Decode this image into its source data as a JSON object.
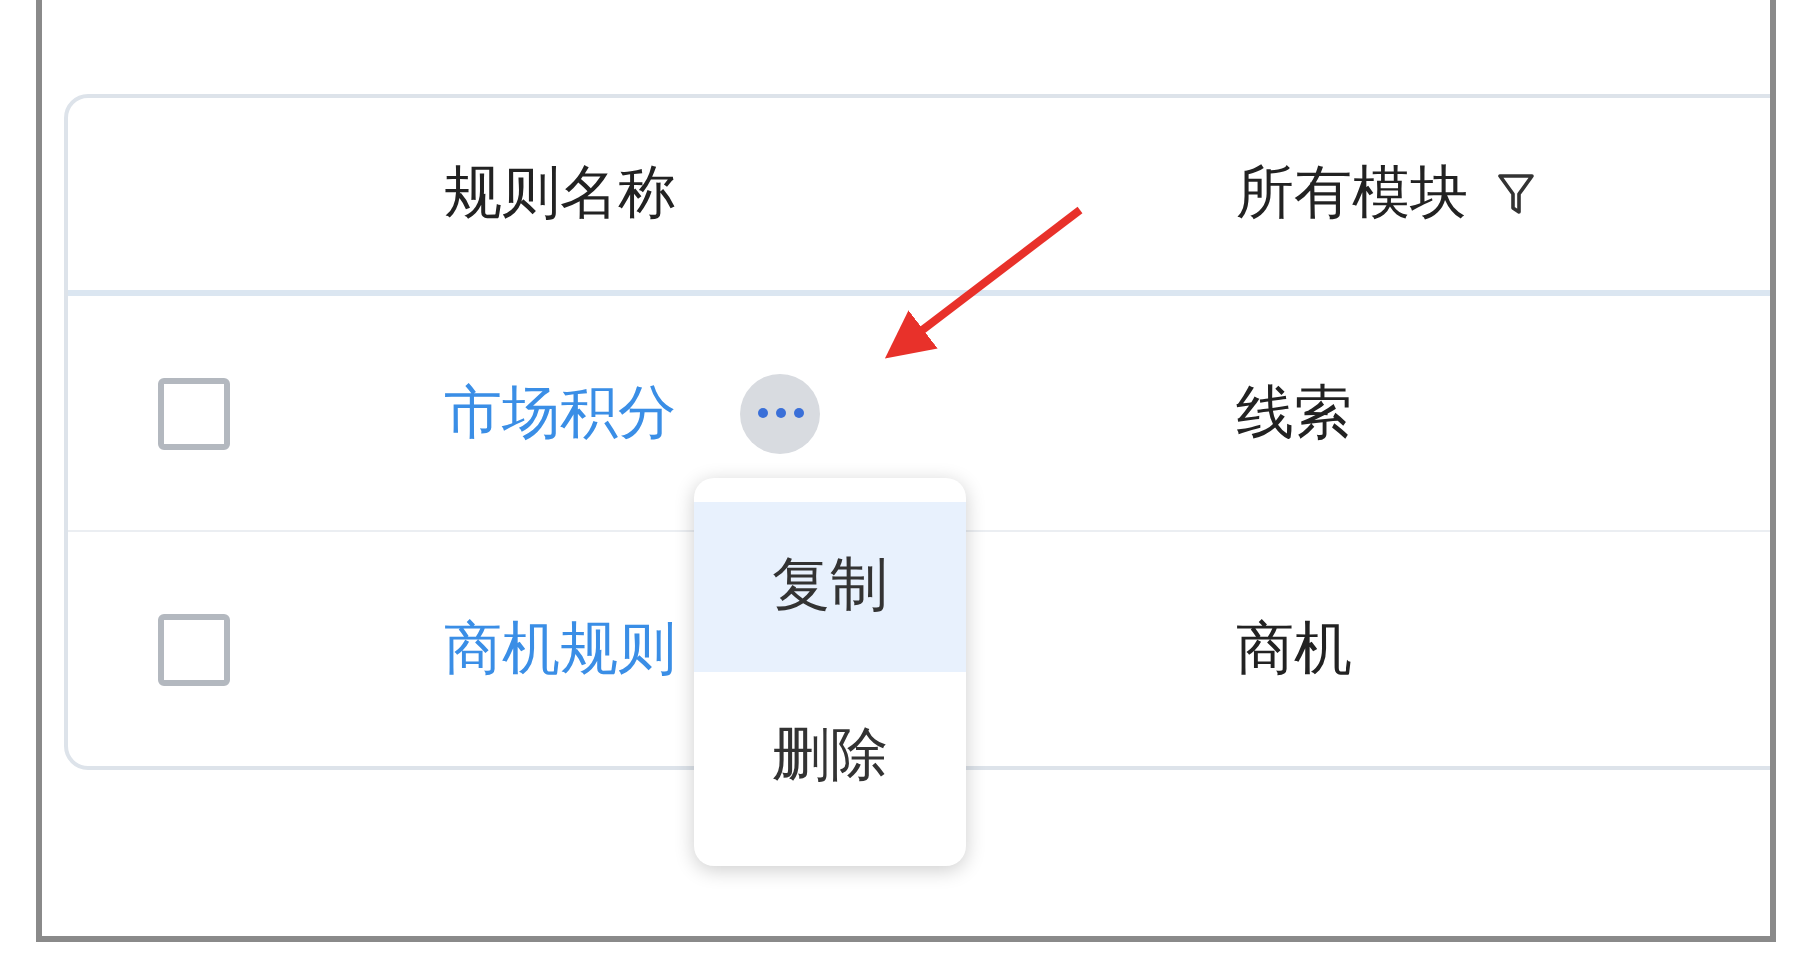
{
  "table": {
    "columns": [
      {
        "label": "规则名称",
        "filter": false
      },
      {
        "label": "所有模块",
        "filter": true
      }
    ],
    "rows": [
      {
        "checked": false,
        "name": "市场积分",
        "module": "线索",
        "more_button": true
      },
      {
        "checked": false,
        "name": "商机规则",
        "module": "商机",
        "more_button": false
      }
    ]
  },
  "context_menu": {
    "items": [
      {
        "label": "复制",
        "selected": true
      },
      {
        "label": "删除",
        "selected": false
      }
    ]
  }
}
